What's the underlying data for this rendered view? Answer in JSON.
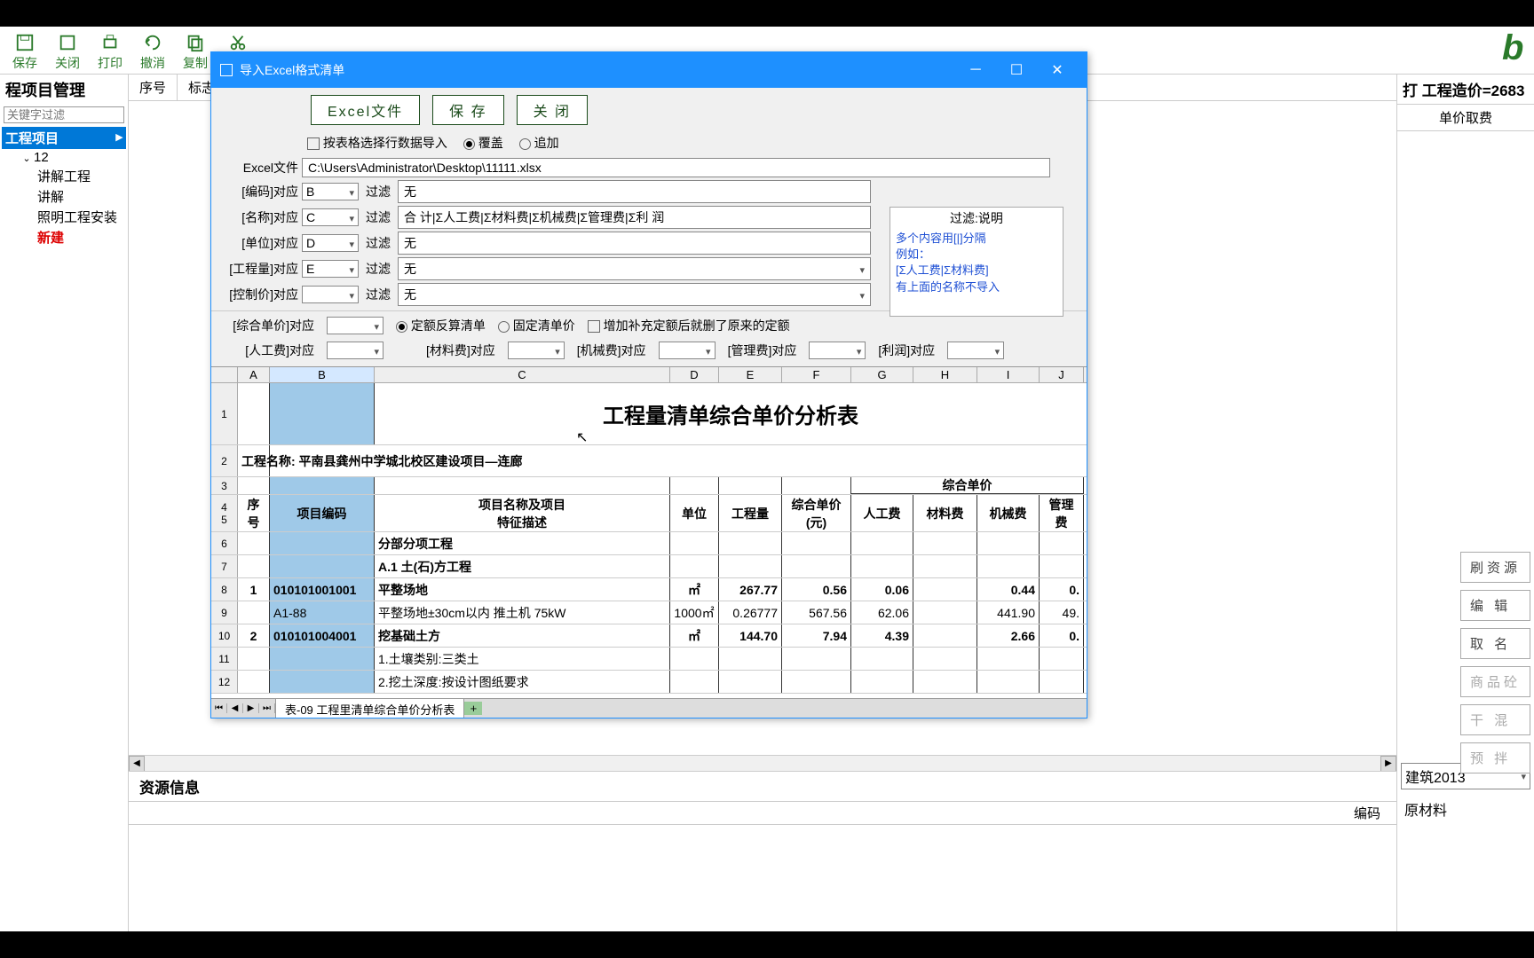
{
  "toolbar": {
    "save": "保存",
    "close": "关闭",
    "print": "打印",
    "undo": "撤消",
    "copy": "复制",
    "cut": "剪切"
  },
  "left_panel": {
    "title": "程项目管理",
    "filter_placeholder": "关键字过滤",
    "tree": {
      "root": "工程项目",
      "n12": "12",
      "items": [
        "讲解工程",
        "讲解",
        "照明工程安装",
        "新建"
      ]
    }
  },
  "center": {
    "col1": "序号",
    "col2": "标志",
    "res_title": "资源信息",
    "res_col1": "编码"
  },
  "right_panel": {
    "title": "打 工程造价=2683",
    "header": "单价取费",
    "type": "建筑2013",
    "mat": "原材料"
  },
  "side_btns": {
    "b1": "刷资源",
    "b2": "编 辑",
    "b3": "取 名",
    "b4": "商品砼",
    "b5": "干 混",
    "b6": "预 拌"
  },
  "dialog": {
    "title": "导入Excel格式清单",
    "btn_excel": "Excel文件",
    "btn_save": "保 存",
    "btn_close": "关 闭",
    "opt_by_format": "按表格选择行数据导入",
    "opt_overwrite": "覆盖",
    "opt_append": "追加",
    "file_label": "Excel文件",
    "file_path": "C:\\Users\\Administrator\\Desktop\\11111.xlsx",
    "mapping": {
      "code_label": "[编码]对应",
      "code_val": "B",
      "name_label": "[名称]对应",
      "name_val": "C",
      "unit_label": "[单位]对应",
      "unit_val": "D",
      "qty_label": "[工程量]对应",
      "qty_val": "E",
      "ctrl_label": "[控制价]对应",
      "ctrl_val": "",
      "filter_label": "过滤",
      "f_none": "无",
      "f_name": "合  计|Σ人工费|Σ材料费|Σ机械费|Σ管理费|Σ利  润"
    },
    "info_box": {
      "title": "过滤:说明",
      "l1": "多个内容用[|]分隔",
      "l2": "例如：",
      "l3": "[Σ人工费|Σ材料费]",
      "l4": "有上面的名称不导入"
    },
    "row2": {
      "comp_price": "[综合单价]对应",
      "r_quota": "定额反算清单",
      "r_fixed": "固定清单价",
      "chk_extra": "增加补充定额后就删了原来的定额",
      "labor": "[人工费]对应",
      "mat": "[材料费]对应",
      "mach": "[机械费]对应",
      "mgmt": "[管理费]对应",
      "profit": "[利润]对应"
    },
    "sheet": {
      "cols": [
        "A",
        "B",
        "C",
        "D",
        "E",
        "F",
        "G",
        "H",
        "I",
        "J"
      ],
      "title": "工程量清单综合单价分析表",
      "project": "工程名称: 平南县龚州中学城北校区建设项目—连廊",
      "hdr": {
        "seq": "序号",
        "code": "项目编码",
        "name": "项目名称及项目\n特征描述",
        "unit": "单位",
        "qty": "工程量",
        "price": "综合单价\n(元)",
        "comp": "综合单价",
        "labor": "人工费",
        "mat": "材料费",
        "mach": "机械费",
        "mgmt": "管理费"
      },
      "rows": [
        {
          "r": 6,
          "c": "分部分项工程"
        },
        {
          "r": 7,
          "c": "A.1 土(石)方工程"
        },
        {
          "r": 8,
          "a": "1",
          "b": "010101001001",
          "c": "平整场地",
          "d": "㎡",
          "e": "267.77",
          "f": "0.56",
          "g": "0.06",
          "h": "",
          "i": "0.44",
          "j": "0."
        },
        {
          "r": 9,
          "a": "",
          "b": "A1-88",
          "c": "平整场地±30cm以内 推土机 75kW",
          "d": "1000㎡",
          "e": "0.26777",
          "f": "567.56",
          "g": "62.06",
          "h": "",
          "i": "441.90",
          "j": "49."
        },
        {
          "r": 10,
          "a": "2",
          "b": "010101004001",
          "c": "挖基础土方",
          "d": "㎡",
          "e": "144.70",
          "f": "7.94",
          "g": "4.39",
          "h": "",
          "i": "2.66",
          "j": "0."
        },
        {
          "r": 11,
          "a": "",
          "b": "",
          "c": "1.土壤类别:三类土"
        },
        {
          "r": 12,
          "a": "",
          "b": "",
          "c": "2.挖土深度:按设计图纸要求"
        }
      ],
      "tab": "表-09 工程里清单综合单价分析表"
    }
  }
}
